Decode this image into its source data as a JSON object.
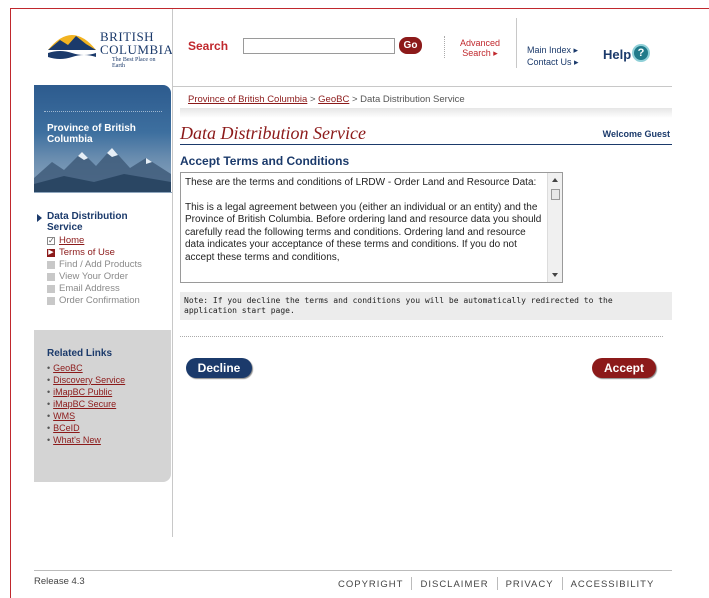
{
  "header": {
    "logo": {
      "line1": "BRITISH",
      "line2": "COLUMBIA",
      "tagline": "The Best Place on Earth"
    },
    "search_label": "Search",
    "search_value": "",
    "go_label": "Go",
    "advanced_search": "Advanced Search ▸",
    "main_index": "Main Index ▸",
    "contact_us": "Contact Us ▸",
    "help_label": "Help",
    "help_glyph": "?"
  },
  "sidebar": {
    "province_title": "Province of British Columbia",
    "nav_title": "Data Distribution Service",
    "nav_items": [
      {
        "label": "Home",
        "state": "done"
      },
      {
        "label": "Terms of Use",
        "state": "current"
      },
      {
        "label": "Find / Add Products",
        "state": "disabled"
      },
      {
        "label": "View Your Order",
        "state": "disabled"
      },
      {
        "label": "Email Address",
        "state": "disabled"
      },
      {
        "label": "Order Confirmation",
        "state": "disabled"
      }
    ],
    "related_title": "Related Links",
    "related_links": [
      "GeoBC",
      "Discovery Service",
      "iMapBC Public",
      "iMapBC Secure",
      "WMS",
      "BCeID",
      "What's New"
    ]
  },
  "breadcrumb": {
    "items": [
      "Province of British Columbia",
      "GeoBC"
    ],
    "current": "Data Distribution Service",
    "separator": ">"
  },
  "main": {
    "page_title": "Data Distribution Service",
    "welcome": "Welcome Guest",
    "section_title": "Accept Terms and Conditions",
    "terms_para1": "These are the terms and conditions of LRDW - Order Land and Resource Data:",
    "terms_para2": "This is a legal agreement between you (either an individual or an entity) and the Province of British Columbia. Before ordering land and resource data you should carefully read the following terms and conditions. Ordering land and resource data indicates your acceptance of these terms and conditions. If you do not accept these terms and conditions,",
    "note": "Note: If you decline the terms and conditions you will be automatically redirected to the application start page.",
    "decline_label": "Decline",
    "accept_label": "Accept"
  },
  "footer": {
    "release": "Release 4.3",
    "links": [
      "COPYRIGHT",
      "DISCLAIMER",
      "PRIVACY",
      "ACCESSIBILITY"
    ]
  },
  "colors": {
    "brand_red": "#8c1a1a",
    "brand_navy": "#1b3a6b",
    "frame_red": "#c0282d"
  }
}
